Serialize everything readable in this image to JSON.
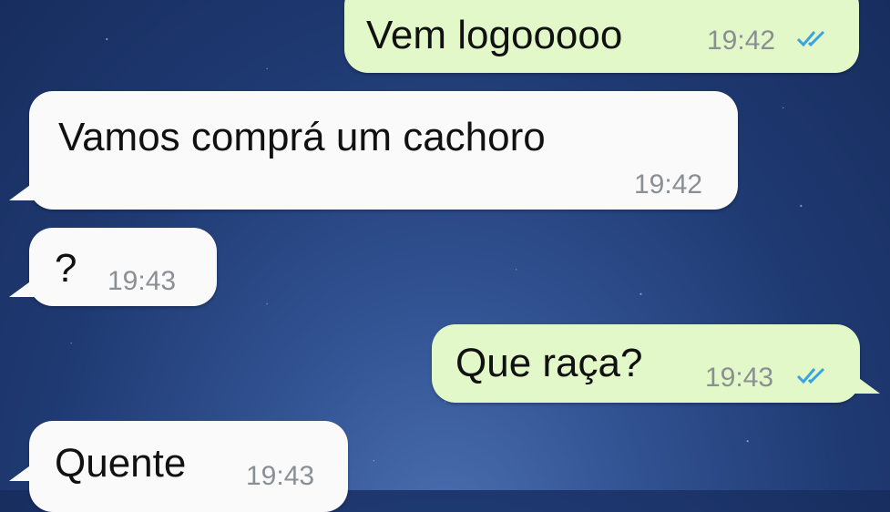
{
  "messages": [
    {
      "direction": "outgoing",
      "text": "Vem logooooo",
      "time": "19:42",
      "status": "read"
    },
    {
      "direction": "incoming",
      "text": "Vamos comprá  um cachoro",
      "time": "19:42"
    },
    {
      "direction": "incoming",
      "text": "?",
      "time": "19:43"
    },
    {
      "direction": "outgoing",
      "text": "Que raça?",
      "time": "19:43",
      "status": "read"
    },
    {
      "direction": "incoming",
      "text": "Quente",
      "time": "19:43"
    }
  ],
  "colors": {
    "incoming_bubble": "#fafafa",
    "outgoing_bubble": "#e2f8c8",
    "read_ticks": "#3ba3e0",
    "time_text": "#8a8f94",
    "background": "#1f3a72"
  },
  "icons": {
    "read_status": "double-check-icon"
  }
}
